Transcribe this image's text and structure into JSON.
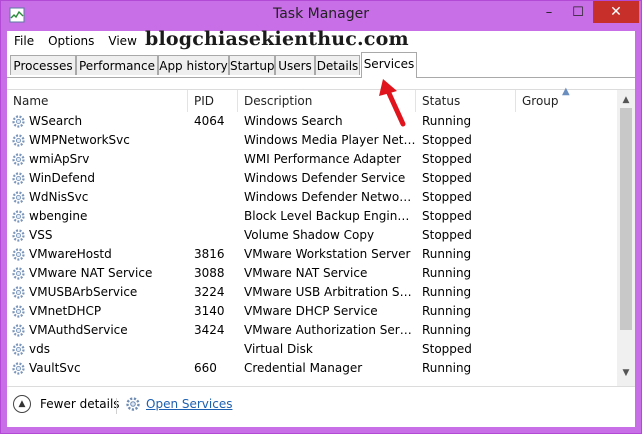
{
  "window": {
    "title": "Task Manager",
    "min_glyph": "–",
    "max_glyph": "☐",
    "close_glyph": "✕"
  },
  "menu": [
    "File",
    "Options",
    "View"
  ],
  "watermark": "blogchiasekienthuc.com",
  "tabs": [
    {
      "label": "Processes",
      "active": false
    },
    {
      "label": "Performance",
      "active": false
    },
    {
      "label": "App history",
      "active": false
    },
    {
      "label": "Startup",
      "active": false
    },
    {
      "label": "Users",
      "active": false
    },
    {
      "label": "Details",
      "active": false
    },
    {
      "label": "Services",
      "active": true
    }
  ],
  "columns": {
    "name": "Name",
    "pid": "PID",
    "description": "Description",
    "status": "Status",
    "group": "Group"
  },
  "rows": [
    {
      "name": "WSearch",
      "pid": "4064",
      "description": "Windows Search",
      "status": "Running"
    },
    {
      "name": "WMPNetworkSvc",
      "pid": "",
      "description": "Windows Media Player Netw...",
      "status": "Stopped"
    },
    {
      "name": "wmiApSrv",
      "pid": "",
      "description": "WMI Performance Adapter",
      "status": "Stopped"
    },
    {
      "name": "WinDefend",
      "pid": "",
      "description": "Windows Defender Service",
      "status": "Stopped"
    },
    {
      "name": "WdNisSvc",
      "pid": "",
      "description": "Windows Defender Network I...",
      "status": "Stopped"
    },
    {
      "name": "wbengine",
      "pid": "",
      "description": "Block Level Backup Engine Se...",
      "status": "Stopped"
    },
    {
      "name": "VSS",
      "pid": "",
      "description": "Volume Shadow Copy",
      "status": "Stopped"
    },
    {
      "name": "VMwareHostd",
      "pid": "3816",
      "description": "VMware Workstation Server",
      "status": "Running"
    },
    {
      "name": "VMware NAT Service",
      "pid": "3088",
      "description": "VMware NAT Service",
      "status": "Running"
    },
    {
      "name": "VMUSBArbService",
      "pid": "3224",
      "description": "VMware USB Arbitration Servi...",
      "status": "Running"
    },
    {
      "name": "VMnetDHCP",
      "pid": "3140",
      "description": "VMware DHCP Service",
      "status": "Running"
    },
    {
      "name": "VMAuthdService",
      "pid": "3424",
      "description": "VMware Authorization Service",
      "status": "Running"
    },
    {
      "name": "vds",
      "pid": "",
      "description": "Virtual Disk",
      "status": "Stopped"
    },
    {
      "name": "VaultSvc",
      "pid": "660",
      "description": "Credential Manager",
      "status": "Running"
    }
  ],
  "footer": {
    "fewer_details": "Fewer details",
    "open_services": "Open Services"
  },
  "colors": {
    "titlebar": "#c86ee6",
    "close": "#c7302a",
    "link": "#1d5fb0",
    "annotation_arrow": "#e0141c"
  },
  "icons": {
    "row_icon": "gear-icon",
    "sort_indicator": "sort-caret-up-icon",
    "footer_toggle": "chevron-up-circle-icon",
    "open_services_icon": "gear-icon",
    "annotation": "red-arrow-icon"
  }
}
